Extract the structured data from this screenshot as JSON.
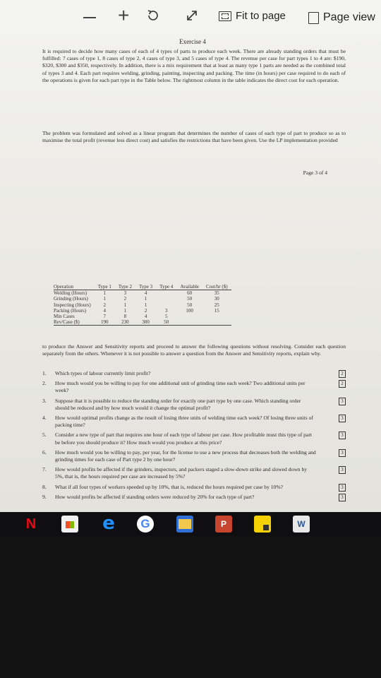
{
  "toolbar": {
    "zoom_out_icon": "minus-icon",
    "zoom_in_icon": "plus-icon",
    "rotate_icon": "rotate-icon",
    "expand_icon": "expand-icon",
    "fit_label": "Fit to page",
    "page_view_label": "Page view"
  },
  "document": {
    "title": "Exercise 4",
    "para1": "It is required to decide how many cases of each of 4 types of parts to produce each week. There are already standing orders that must be fulfilled: 7 cases of type 1, 8 cases of type 2, 4 cases of type 3, and 5 cases of type 4. The revenue per case for part types 1 to 4 are: $190, $320, $300 and $350, respectively. In addition, there is a mix requirement that at least as many type 1 parts are needed as the combined total of types 3 and 4. Each part requires welding, grinding, painting, inspecting and packing. The time (in hours) per case required to do each of the operations is given for each part type in the Table below. The rightmost column in the table indicates the direct cost for each operation.",
    "para2": "The problem was formulated and solved as a linear program that determines the number of cases of each type of part to produce so as to maximise the total profit (revenue less direct cost) and satisfies the restrictions that have been given. Use the LP implementation provided",
    "page_number": "Page 3 of 4",
    "table": {
      "headers": [
        "Operation",
        "Type 1",
        "Type 2",
        "Type 3",
        "Type 4",
        "Available",
        "Cost/hr ($)"
      ],
      "rows": [
        [
          "Welding (Hours)",
          "1",
          "3",
          "4",
          "",
          "60",
          "35"
        ],
        [
          "Grinding (Hours)",
          "1",
          "2",
          "1",
          "",
          "50",
          "30"
        ],
        [
          "Inspecting (Hours)",
          "2",
          "1",
          "1",
          "",
          "50",
          "25"
        ],
        [
          "Packing (Hours)",
          "4",
          "1",
          "2",
          "3",
          "100",
          "15"
        ],
        [
          "Min Cases",
          "7",
          "8",
          "4",
          "5",
          "",
          ""
        ],
        [
          "Rev/Case ($)",
          "190",
          "230",
          "300",
          "50",
          "",
          ""
        ]
      ]
    },
    "para3": "to produce the Answer and Sensitivity reports and proceed to answer the following questions without resolving. Consider each question separately from the others. Whenever it is not possible to answer a question from the Answer and Sensitivity reports, explain why.",
    "questions": [
      {
        "num": "1.",
        "text": "Which types of labour currently limit profit?",
        "marks": "2"
      },
      {
        "num": "2.",
        "text": "How much would you be willing to pay for one additional unit of grinding time each week? Two additional units per week?",
        "marks": "2"
      },
      {
        "num": "3.",
        "text": "Suppose that it is possible to reduce the standing order for exactly one part type by one case. Which standing order should be reduced and by how much would it change the optimal profit?",
        "marks": "3"
      },
      {
        "num": "4.",
        "text": "How would optimal profits change as the result of losing three units of welding time each week? Of losing three units of packing time?",
        "marks": "3"
      },
      {
        "num": "5.",
        "text": "Consider a new type of part that requires one hour of each type of labour per case. How profitable must this type of part be before you should produce it? How much would you produce at this price?",
        "marks": "3"
      },
      {
        "num": "6.",
        "text": "How much would you be willing to pay, per year, for the license to use a new process that decreases both the welding and grinding times for each case of Part type 2 by one hour?",
        "marks": "3"
      },
      {
        "num": "7.",
        "text": "How would profits be affected if the grinders, inspectors, and packers staged a slow-down strike and slowed down by 5%, that is, the hours required per case are increased by 5%?",
        "marks": "3"
      },
      {
        "num": "8.",
        "text": "What if all four types of workers speeded up by 10%, that is, reduced the hours required per case by 10%?",
        "marks": "3"
      },
      {
        "num": "9.",
        "text": "How would profits be affected if standing orders were reduced by 20% for each type of part?",
        "marks": "3"
      }
    ]
  },
  "taskbar": {
    "netflix_glyph": "N",
    "edge_glyph": "e",
    "google_glyph": "G",
    "ppt_glyph": "P",
    "word_glyph": "W",
    "icons": [
      "netflix-icon",
      "store-icon",
      "edge-icon",
      "google-icon",
      "file-explorer-icon",
      "powerpoint-icon",
      "sticky-notes-icon",
      "word-icon"
    ]
  }
}
